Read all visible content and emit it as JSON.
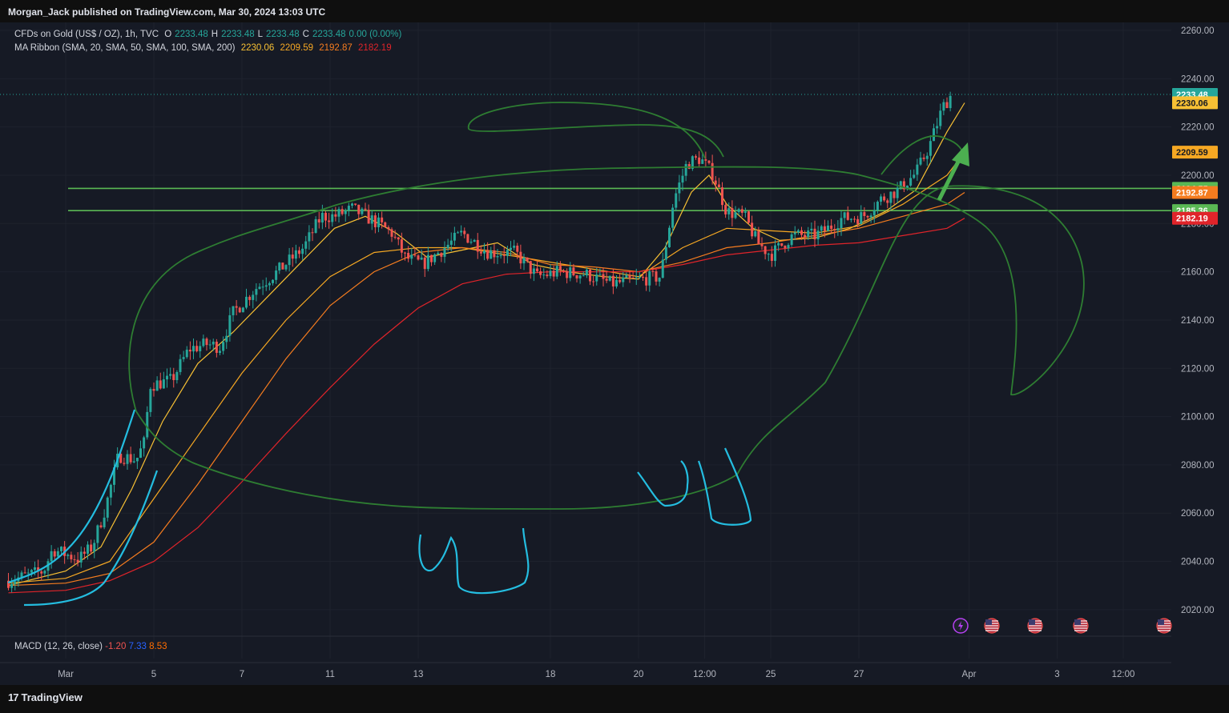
{
  "publisher": "Morgan_Jack published on TradingView.com, Mar 30, 2024 13:03 UTC",
  "legend": {
    "symbol": "CFDs on Gold (US$ / OZ), 1h, TVC",
    "o_label": "O",
    "o": "2233.48",
    "h_label": "H",
    "h": "2233.48",
    "l_label": "L",
    "l": "2233.48",
    "c_label": "C",
    "c": "2233.48",
    "change": "0.00 (0.00%)",
    "ma_label": "MA Ribbon (SMA, 20, SMA, 50, SMA, 100, SMA, 200)",
    "ma20": "2230.06",
    "ma50": "2209.59",
    "ma100": "2192.87",
    "ma200": "2182.19"
  },
  "macd": {
    "label": "MACD (12, 26, close)",
    "macd": "-1.20",
    "signal": "7.33",
    "hist": "8.53"
  },
  "brand": "TradingView",
  "colors": {
    "bg": "#161a25",
    "up": "#26a69a",
    "down": "#ef5350",
    "ma20": "#f7c034",
    "ma50": "#f6a823",
    "ma100": "#f57c1f",
    "ma200": "#e0242a",
    "hline": "#5ab854",
    "drawing_green": "#2e7d32",
    "drawing_cyan": "#24bde0"
  },
  "chart_data": {
    "type": "candlestick",
    "title": "CFDs on Gold (US$ / OZ), 1h, TVC",
    "ylim": [
      2012,
      2262
    ],
    "y_ticks": [
      2260,
      2240,
      2220,
      2200,
      2180,
      2160,
      2140,
      2120,
      2100,
      2080,
      2060,
      2040,
      2020
    ],
    "x_ticks": [
      {
        "label": "Mar",
        "x": 0
      },
      {
        "label": "5",
        "x": 2
      },
      {
        "label": "7",
        "x": 4
      },
      {
        "label": "11",
        "x": 6
      },
      {
        "label": "13",
        "x": 8
      },
      {
        "label": "18",
        "x": 11
      },
      {
        "label": "20",
        "x": 13
      },
      {
        "label": "12:00",
        "x": 14.5
      },
      {
        "label": "25",
        "x": 16
      },
      {
        "label": "27",
        "x": 18
      },
      {
        "label": "Apr",
        "x": 20.5
      },
      {
        "label": "3",
        "x": 22.5
      },
      {
        "label": "12:00",
        "x": 24
      }
    ],
    "price_path": [
      [
        -1.3,
        2032
      ],
      [
        -0.5,
        2036
      ],
      [
        -0.3,
        2045
      ],
      [
        0.3,
        2041
      ],
      [
        0.6,
        2046
      ],
      [
        0.9,
        2062
      ],
      [
        1.2,
        2084
      ],
      [
        1.6,
        2082
      ],
      [
        1.8,
        2090
      ],
      [
        1.9,
        2113
      ],
      [
        2.4,
        2115
      ],
      [
        2.8,
        2128
      ],
      [
        3.2,
        2130
      ],
      [
        3.5,
        2129
      ],
      [
        3.8,
        2143
      ],
      [
        4.3,
        2153
      ],
      [
        4.8,
        2160
      ],
      [
        5.4,
        2170
      ],
      [
        5.8,
        2183
      ],
      [
        6.1,
        2183
      ],
      [
        6.5,
        2186
      ],
      [
        7,
        2181
      ],
      [
        7.4,
        2176
      ],
      [
        7.7,
        2166
      ],
      [
        8.1,
        2163
      ],
      [
        8.6,
        2170
      ],
      [
        9,
        2176
      ],
      [
        9.6,
        2168
      ],
      [
        10.2,
        2168
      ],
      [
        10.7,
        2158
      ],
      [
        11.2,
        2160
      ],
      [
        11.8,
        2159
      ],
      [
        12.4,
        2155
      ],
      [
        13.1,
        2157
      ],
      [
        13.5,
        2158
      ],
      [
        13.8,
        2190
      ],
      [
        14.1,
        2205
      ],
      [
        14.4,
        2207
      ],
      [
        14.7,
        2200
      ],
      [
        15,
        2185
      ],
      [
        15.4,
        2183
      ],
      [
        15.7,
        2172
      ],
      [
        16,
        2167
      ],
      [
        16.5,
        2175
      ],
      [
        17,
        2175
      ],
      [
        17.3,
        2178
      ],
      [
        17.6,
        2182
      ],
      [
        18.1,
        2183
      ],
      [
        18.5,
        2190
      ],
      [
        18.9,
        2194
      ],
      [
        19.3,
        2201
      ],
      [
        19.6,
        2212
      ],
      [
        19.9,
        2228
      ],
      [
        20.1,
        2233.48
      ]
    ],
    "horizontal_levels": [
      2194.55,
      2185.36
    ],
    "last_price": 2233.48,
    "price_badges": [
      {
        "label": "2233.48",
        "value": 2233.48,
        "color": "#26a69a",
        "text": "#ffffff"
      },
      {
        "label": "2230.06",
        "value": 2230.06,
        "color": "#f7c034",
        "text": "#131722"
      },
      {
        "label": "2209.59",
        "value": 2209.59,
        "color": "#f6a823",
        "text": "#131722"
      },
      {
        "label": "2194.55",
        "value": 2194.55,
        "color": "#5ab854",
        "text": "#ffffff"
      },
      {
        "label": "2192.87",
        "value": 2192.87,
        "color": "#f57c1f",
        "text": "#ffffff"
      },
      {
        "label": "2185.36",
        "value": 2185.36,
        "color": "#5ab854",
        "text": "#ffffff"
      },
      {
        "label": "2182.19",
        "value": 2182.19,
        "color": "#e0242a",
        "text": "#ffffff"
      }
    ],
    "moving_averages": [
      {
        "name": "SMA 20",
        "color": "#f7c034",
        "points": [
          [
            -1.3,
            2030
          ],
          [
            0,
            2036
          ],
          [
            0.8,
            2046
          ],
          [
            1.5,
            2070
          ],
          [
            2.2,
            2098
          ],
          [
            3,
            2122
          ],
          [
            3.8,
            2135
          ],
          [
            4.6,
            2150
          ],
          [
            5.4,
            2165
          ],
          [
            6.1,
            2178
          ],
          [
            6.8,
            2183
          ],
          [
            7.5,
            2176
          ],
          [
            8.2,
            2166
          ],
          [
            9,
            2169
          ],
          [
            9.8,
            2172
          ],
          [
            10.6,
            2163
          ],
          [
            11.4,
            2160
          ],
          [
            12.2,
            2158
          ],
          [
            13,
            2157
          ],
          [
            13.6,
            2170
          ],
          [
            14.2,
            2193
          ],
          [
            14.6,
            2200
          ],
          [
            15,
            2188
          ],
          [
            15.6,
            2178
          ],
          [
            16.2,
            2173
          ],
          [
            17,
            2174
          ],
          [
            17.8,
            2178
          ],
          [
            18.6,
            2185
          ],
          [
            19.3,
            2194
          ],
          [
            20,
            2218
          ],
          [
            20.4,
            2230
          ]
        ]
      },
      {
        "name": "SMA 50",
        "color": "#f6a823",
        "points": [
          [
            -1.3,
            2031
          ],
          [
            0,
            2033
          ],
          [
            1,
            2040
          ],
          [
            2,
            2066
          ],
          [
            3,
            2092
          ],
          [
            4,
            2118
          ],
          [
            5,
            2140
          ],
          [
            6,
            2158
          ],
          [
            7,
            2168
          ],
          [
            8,
            2170
          ],
          [
            9,
            2170
          ],
          [
            10,
            2167
          ],
          [
            11,
            2164
          ],
          [
            12,
            2161
          ],
          [
            13,
            2158
          ],
          [
            14,
            2170
          ],
          [
            15,
            2178
          ],
          [
            16,
            2177
          ],
          [
            17,
            2176
          ],
          [
            18,
            2179
          ],
          [
            19,
            2188
          ],
          [
            20,
            2200
          ],
          [
            20.4,
            2209.59
          ]
        ]
      },
      {
        "name": "SMA 100",
        "color": "#f57c1f",
        "points": [
          [
            -1.3,
            2030
          ],
          [
            0,
            2031
          ],
          [
            1,
            2035
          ],
          [
            2,
            2048
          ],
          [
            3,
            2072
          ],
          [
            4,
            2098
          ],
          [
            5,
            2124
          ],
          [
            6,
            2146
          ],
          [
            7,
            2160
          ],
          [
            8,
            2168
          ],
          [
            9,
            2170
          ],
          [
            10,
            2168
          ],
          [
            11,
            2163
          ],
          [
            12,
            2162
          ],
          [
            13,
            2160
          ],
          [
            14,
            2164
          ],
          [
            15,
            2170
          ],
          [
            16,
            2172
          ],
          [
            17,
            2175
          ],
          [
            18,
            2178
          ],
          [
            19,
            2183
          ],
          [
            20,
            2188
          ],
          [
            20.4,
            2192.87
          ]
        ]
      },
      {
        "name": "SMA 200",
        "color": "#e0242a",
        "points": [
          [
            -1.3,
            2027
          ],
          [
            0,
            2028
          ],
          [
            1,
            2032
          ],
          [
            2,
            2040
          ],
          [
            3,
            2054
          ],
          [
            4,
            2073
          ],
          [
            5,
            2093
          ],
          [
            6,
            2112
          ],
          [
            7,
            2130
          ],
          [
            8,
            2145
          ],
          [
            9,
            2155
          ],
          [
            10,
            2159
          ],
          [
            11,
            2160
          ],
          [
            12,
            2160
          ],
          [
            13,
            2160
          ],
          [
            14,
            2163
          ],
          [
            15,
            2167
          ],
          [
            16,
            2169
          ],
          [
            17,
            2171
          ],
          [
            18,
            2172
          ],
          [
            19,
            2175
          ],
          [
            20,
            2178
          ],
          [
            20.4,
            2182.19
          ]
        ]
      }
    ],
    "event_markers": [
      "lightning-icon",
      "us-flag-icon",
      "us-flag-icon",
      "us-flag-icon",
      "us-flag-icon"
    ]
  }
}
